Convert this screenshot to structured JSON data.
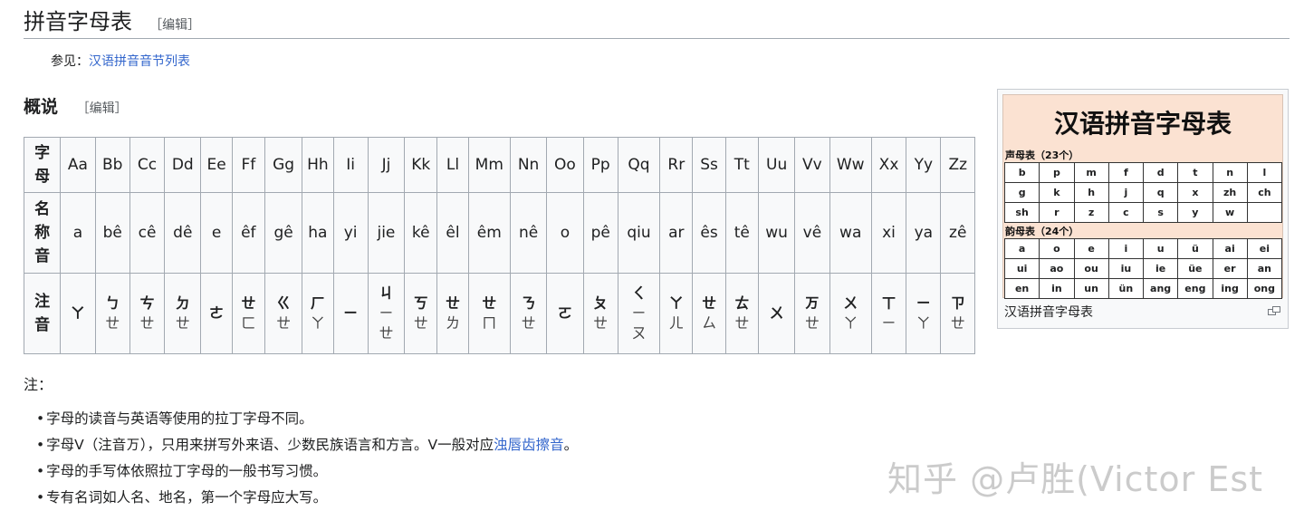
{
  "heading": {
    "title": "拼音字母表",
    "edit": "［编辑］"
  },
  "see_also": {
    "label": "参见：",
    "link": "汉语拼音音节列表"
  },
  "section": {
    "title": "概说",
    "edit": "［编辑］"
  },
  "table": {
    "row_headers": [
      "字母",
      "名称音",
      "注音"
    ],
    "letters": [
      "Aa",
      "Bb",
      "Cc",
      "Dd",
      "Ee",
      "Ff",
      "Gg",
      "Hh",
      "Ii",
      "Jj",
      "Kk",
      "Ll",
      "Mm",
      "Nn",
      "Oo",
      "Pp",
      "Qq",
      "Rr",
      "Ss",
      "Tt",
      "Uu",
      "Vv",
      "Ww",
      "Xx",
      "Yy",
      "Zz"
    ],
    "names": [
      "a",
      "bê",
      "cê",
      "dê",
      "e",
      "êf",
      "gê",
      "ha",
      "yi",
      "jie",
      "kê",
      "êl",
      "êm",
      "nê",
      "o",
      "pê",
      "qiu",
      "ar",
      "ês",
      "tê",
      "wu",
      "vê",
      "wa",
      "xi",
      "ya",
      "zê"
    ],
    "zhuyin": [
      [
        "ㄚ"
      ],
      [
        "ㄅ",
        "ㄝ"
      ],
      [
        "ㄘ",
        "ㄝ"
      ],
      [
        "ㄉ",
        "ㄝ"
      ],
      [
        "ㄜ"
      ],
      [
        "ㄝ",
        "ㄈ"
      ],
      [
        "ㄍ",
        "ㄝ"
      ],
      [
        "ㄏ",
        "ㄚ"
      ],
      [
        "ㄧ"
      ],
      [
        "ㄐ",
        "ㄧ",
        "ㄝ"
      ],
      [
        "ㄎ",
        "ㄝ"
      ],
      [
        "ㄝ",
        "ㄌ"
      ],
      [
        "ㄝ",
        "ㄇ"
      ],
      [
        "ㄋ",
        "ㄝ"
      ],
      [
        "ㄛ"
      ],
      [
        "ㄆ",
        "ㄝ"
      ],
      [
        "ㄑ",
        "ㄧ",
        "ㄡ"
      ],
      [
        "ㄚ",
        "ㄦ"
      ],
      [
        "ㄝ",
        "ㄙ"
      ],
      [
        "ㄊ",
        "ㄝ"
      ],
      [
        "ㄨ"
      ],
      [
        "ㄪ",
        "ㄝ"
      ],
      [
        "ㄨ",
        "ㄚ"
      ],
      [
        "ㄒ",
        "ㄧ"
      ],
      [
        "ㄧ",
        "ㄚ"
      ],
      [
        "ㄗ",
        "ㄝ"
      ]
    ]
  },
  "notes": {
    "label": "注：",
    "items": [
      {
        "text": "字母的读音与英语等使用的拉丁字母不同。"
      },
      {
        "text": "字母V（注音ㄪ），只用来拼写外来语、少数民族语言和方言。V一般对应",
        "link": "浊唇齿擦音",
        "after": "。"
      },
      {
        "text": "字母的手写体依照拉丁字母的一般书写习惯。"
      },
      {
        "text": "专有名词如人名、地名，第一个字母应大写。"
      }
    ]
  },
  "thumb": {
    "title": "汉语拼音字母表",
    "initials_label": "声母表（23个）",
    "initials": [
      [
        "b",
        "p",
        "m",
        "f",
        "d",
        "t",
        "n",
        "l"
      ],
      [
        "g",
        "k",
        "h",
        "j",
        "q",
        "x",
        "zh",
        "ch"
      ],
      [
        "sh",
        "r",
        "z",
        "c",
        "s",
        "y",
        "w",
        ""
      ]
    ],
    "finals_label": "韵母表（24个）",
    "finals": [
      [
        "a",
        "o",
        "e",
        "i",
        "u",
        "ü",
        "ai",
        "ei"
      ],
      [
        "ui",
        "ao",
        "ou",
        "iu",
        "ie",
        "üe",
        "er",
        "an"
      ],
      [
        "en",
        "in",
        "un",
        "ün",
        "ang",
        "eng",
        "ing",
        "ong"
      ]
    ],
    "caption": "汉语拼音字母表",
    "enlarge_icon": "enlarge-icon"
  },
  "watermark": "知乎 @卢胜(Victor Est"
}
